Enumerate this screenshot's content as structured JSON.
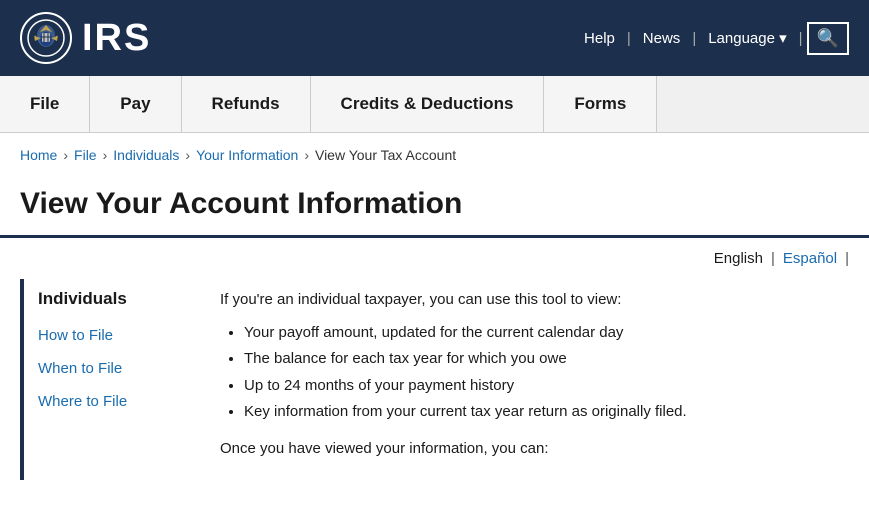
{
  "header": {
    "logo_text": "IRS",
    "logo_eagle": "🦅",
    "nav": {
      "help": "Help",
      "news": "News",
      "language": "Language",
      "language_arrow": "▾"
    }
  },
  "main_nav": {
    "items": [
      {
        "label": "File",
        "id": "file"
      },
      {
        "label": "Pay",
        "id": "pay"
      },
      {
        "label": "Refunds",
        "id": "refunds"
      },
      {
        "label": "Credits & Deductions",
        "id": "credits"
      },
      {
        "label": "Forms",
        "id": "forms"
      }
    ]
  },
  "breadcrumb": {
    "home": "Home",
    "file": "File",
    "individuals": "Individuals",
    "your_information": "Your Information",
    "current": "View Your Tax Account"
  },
  "page_title": "View Your Account Information",
  "languages": {
    "english": "English",
    "spanish": "Español"
  },
  "sidebar": {
    "title": "Individuals",
    "links": [
      {
        "label": "How to File",
        "id": "how-to-file"
      },
      {
        "label": "When to File",
        "id": "when-to-file"
      },
      {
        "label": "Where to File",
        "id": "where-to-file"
      }
    ]
  },
  "main_content": {
    "intro": "If you're an individual taxpayer, you can use this tool to view:",
    "bullets": [
      "Your payoff amount, updated for the current calendar day",
      "The balance for each tax year for which you owe",
      "Up to 24 months of your payment history",
      "Key information from your current tax year return as originally filed."
    ],
    "after_view": "Once you have viewed your information, you can:"
  }
}
